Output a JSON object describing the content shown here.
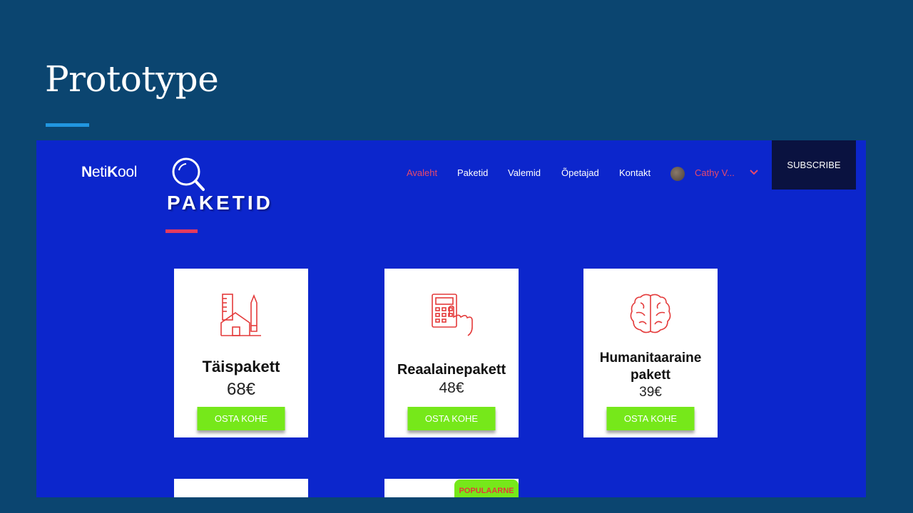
{
  "slide": {
    "title": "Prototype"
  },
  "site": {
    "logo_bold": "N",
    "logo_part1": "eti",
    "logo_bold2": "K",
    "logo_part2": "ool",
    "page_heading": "PAKETID",
    "nav": [
      "Avaleht",
      "Paketid",
      "Valemid",
      "Õpetajad",
      "Kontakt"
    ],
    "active_nav": "Avaleht",
    "user_name": "Cathy V...",
    "subscribe_label": "SUBSCRIBE",
    "colors": {
      "accent": "#e8496c",
      "buy": "#76e81a",
      "background": "#0c26cc"
    }
  },
  "cards": [
    {
      "title": "Täispakett",
      "price": "68€",
      "button": "OSTA KOHE",
      "icon": "architecture-icon"
    },
    {
      "title": "Reaalainepakett",
      "price": "48€",
      "button": "OSTA KOHE",
      "icon": "calculator-icon"
    },
    {
      "title_line1": "Humanitaaraine",
      "title_line2": "pakett",
      "price": "39€",
      "button": "OSTA KOHE",
      "icon": "brain-icon"
    }
  ],
  "badge": {
    "label": "POPULAARNE"
  }
}
